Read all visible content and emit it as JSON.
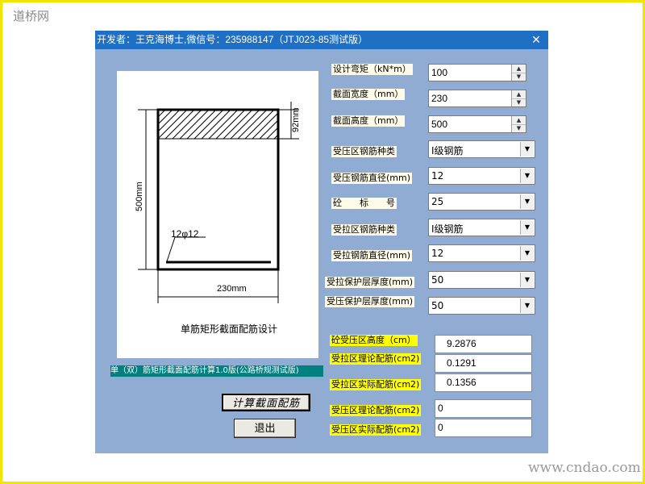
{
  "page": {
    "site_logo": "道桥网",
    "site_url": "www.cndao.com"
  },
  "window": {
    "title": "开发者：王克海博士,微信号：235988147（JTJ023-85测试版）",
    "close_icon": "close-icon",
    "title_bar_color": "#1f6fc5",
    "background_color": "#90acd2"
  },
  "drawing": {
    "dim_width": "230mm",
    "dim_height": "500mm",
    "dim_compression": "92mm",
    "bar_label": "12φ12",
    "caption": "单筋矩形截面配筋设计"
  },
  "version_text": "单（双）筋矩形截面配筋计算1.0版(公路桥规测试版)",
  "buttons": {
    "calculate": "计算截面配筋",
    "exit": "退出"
  },
  "inputs": {
    "moment": {
      "label": "设计弯矩（kN*m）",
      "value": "100"
    },
    "width": {
      "label": "截面宽度（mm）",
      "value": "230"
    },
    "height": {
      "label": "截面高度（mm）",
      "value": "500"
    },
    "comp_steel_type": {
      "label": "受压区钢筋种类",
      "value": "I级钢筋"
    },
    "comp_steel_diameter": {
      "label": "受压钢筋直径(mm)",
      "value": "12"
    },
    "concrete_grade": {
      "label": "砼　　标　　号",
      "value": "25"
    },
    "tens_steel_type": {
      "label": "受拉区钢筋种类",
      "value": "I级钢筋"
    },
    "tens_steel_diameter": {
      "label": "受拉钢筋直径(mm)",
      "value": "12"
    },
    "tens_cover": {
      "label": "受拉保护层厚度(mm)",
      "value": "50"
    },
    "comp_cover": {
      "label": "受压保护层厚度(mm)",
      "value": "50"
    }
  },
  "results": {
    "comp_zone_height": {
      "label": "砼受压区高度（cm）",
      "value": "9.2876"
    },
    "tens_theoretical": {
      "label": "受拉区理论配筋(cm2)",
      "value": "0.1291"
    },
    "tens_actual": {
      "label": "受拉区实际配筋(cm2)",
      "value": "0.1356"
    },
    "comp_theoretical": {
      "label": "受压区理论配筋(cm2)",
      "value": "0"
    },
    "comp_actual": {
      "label": "受压区实际配筋(cm2)",
      "value": "0"
    }
  }
}
